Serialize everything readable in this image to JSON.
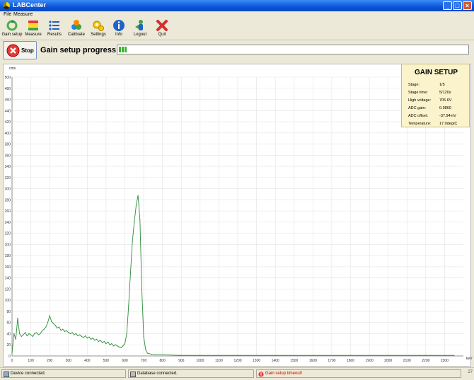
{
  "window": {
    "title": "LABCenter"
  },
  "menu": [
    "File",
    "Measure"
  ],
  "toolbar": [
    {
      "label": "Gain setup",
      "icon": "gain-setup-icon"
    },
    {
      "label": "Measure",
      "icon": "measure-icon"
    },
    {
      "label": "Results",
      "icon": "results-icon"
    },
    {
      "label": "Calibrate",
      "icon": "calibrate-icon"
    },
    {
      "label": "Settings",
      "icon": "settings-icon"
    },
    {
      "label": "Info",
      "icon": "info-icon"
    },
    {
      "label": "Logout",
      "icon": "logout-icon"
    },
    {
      "label": "Quit",
      "icon": "quit-icon"
    }
  ],
  "control": {
    "stop_label": "Stop",
    "progress_label": "Gain setup progress:",
    "progress_fraction": 0.025,
    "progress_color": "#35b52c"
  },
  "gain_setup": {
    "title": "GAIN SETUP",
    "rows": [
      {
        "label": "Stage:",
        "value": "1/5"
      },
      {
        "label": "Stage time:",
        "value": "5/120s"
      },
      {
        "label": "High voltage:",
        "value": "705.6V"
      },
      {
        "label": "ADC gain:",
        "value": "0.9860"
      },
      {
        "label": "ADC offset:",
        "value": "-37.94mV"
      },
      {
        "label": "Temperature:",
        "value": "17.0deg/C"
      }
    ]
  },
  "chart_data": {
    "type": "line",
    "xlabel": "keV",
    "ylabel": "cnts",
    "xlim": [
      0,
      2400
    ],
    "ylim": [
      0,
      500
    ],
    "x_ticks": [
      0,
      100,
      200,
      300,
      400,
      500,
      600,
      700,
      800,
      900,
      1000,
      1100,
      1200,
      1300,
      1400,
      1500,
      1600,
      1700,
      1800,
      1900,
      2000,
      2100,
      2200,
      2300
    ],
    "y_ticks": [
      0,
      20,
      40,
      60,
      80,
      100,
      120,
      140,
      160,
      180,
      200,
      220,
      240,
      260,
      280,
      300,
      320,
      340,
      360,
      380,
      400,
      420,
      440,
      460,
      480,
      500
    ],
    "grid": true,
    "series": [
      {
        "color": "#2e8b3a",
        "x": [
          0,
          10,
          20,
          30,
          40,
          50,
          60,
          70,
          80,
          90,
          100,
          110,
          120,
          130,
          140,
          150,
          160,
          170,
          180,
          190,
          200,
          210,
          220,
          230,
          240,
          250,
          260,
          270,
          280,
          290,
          300,
          310,
          320,
          330,
          340,
          350,
          360,
          370,
          380,
          390,
          400,
          410,
          420,
          430,
          440,
          450,
          460,
          470,
          480,
          490,
          500,
          510,
          520,
          530,
          540,
          550,
          560,
          570,
          580,
          590,
          600,
          610,
          620,
          630,
          640,
          650,
          660,
          670,
          680,
          690,
          700,
          710,
          720,
          740,
          760,
          800,
          900,
          1000,
          1200,
          1400,
          1600,
          1800,
          2000,
          2200,
          2350
        ],
        "y": [
          5,
          40,
          30,
          68,
          40,
          35,
          38,
          42,
          36,
          40,
          38,
          35,
          40,
          42,
          38,
          40,
          45,
          48,
          52,
          60,
          72,
          62,
          58,
          55,
          50,
          52,
          46,
          48,
          44,
          45,
          42,
          40,
          42,
          38,
          40,
          36,
          38,
          35,
          33,
          36,
          32,
          34,
          30,
          32,
          28,
          30,
          26,
          28,
          24,
          26,
          22,
          25,
          20,
          22,
          18,
          20,
          18,
          16,
          15,
          18,
          22,
          40,
          90,
          150,
          205,
          240,
          270,
          288,
          245,
          120,
          35,
          12,
          5,
          3,
          2,
          2,
          1,
          1,
          1,
          1,
          1,
          1,
          1,
          1,
          1
        ]
      }
    ]
  },
  "status": {
    "device": "Device connected.",
    "database": "Database connected.",
    "alert": "Gain setup timeout!",
    "alert_color": "#cc0000",
    "corner": "27"
  }
}
